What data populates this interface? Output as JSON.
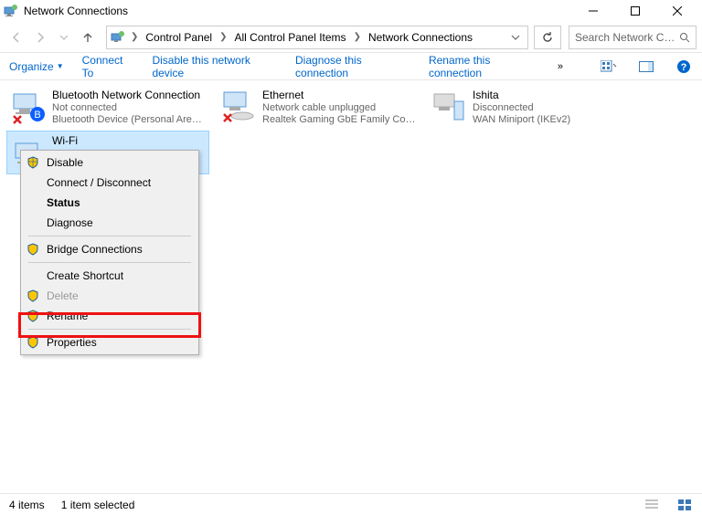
{
  "window": {
    "title": "Network Connections"
  },
  "breadcrumb": {
    "seg0": "Control Panel",
    "seg1": "All Control Panel Items",
    "seg2": "Network Connections"
  },
  "search": {
    "placeholder": "Search Network Con..."
  },
  "toolbar": {
    "organize": "Organize",
    "connect_to": "Connect To",
    "disable": "Disable this network device",
    "diagnose": "Diagnose this connection",
    "rename": "Rename this connection",
    "more": "»"
  },
  "adapters": [
    {
      "name": "Bluetooth Network Connection",
      "status": "Not connected",
      "device": "Bluetooth Device (Personal Area ..."
    },
    {
      "name": "Ethernet",
      "status": "Network cable unplugged",
      "device": "Realtek Gaming GbE Family Contr..."
    },
    {
      "name": "Ishita",
      "status": "Disconnected",
      "device": "WAN Miniport (IKEv2)"
    },
    {
      "name": "Wi-Fi",
      "status": "",
      "device": ""
    }
  ],
  "context_menu": {
    "disable": "Disable",
    "connect": "Connect / Disconnect",
    "status": "Status",
    "diagnose": "Diagnose",
    "bridge": "Bridge Connections",
    "shortcut": "Create Shortcut",
    "delete": "Delete",
    "rename": "Rename",
    "properties": "Properties"
  },
  "statusbar": {
    "count": "4 items",
    "selected": "1 item selected"
  }
}
